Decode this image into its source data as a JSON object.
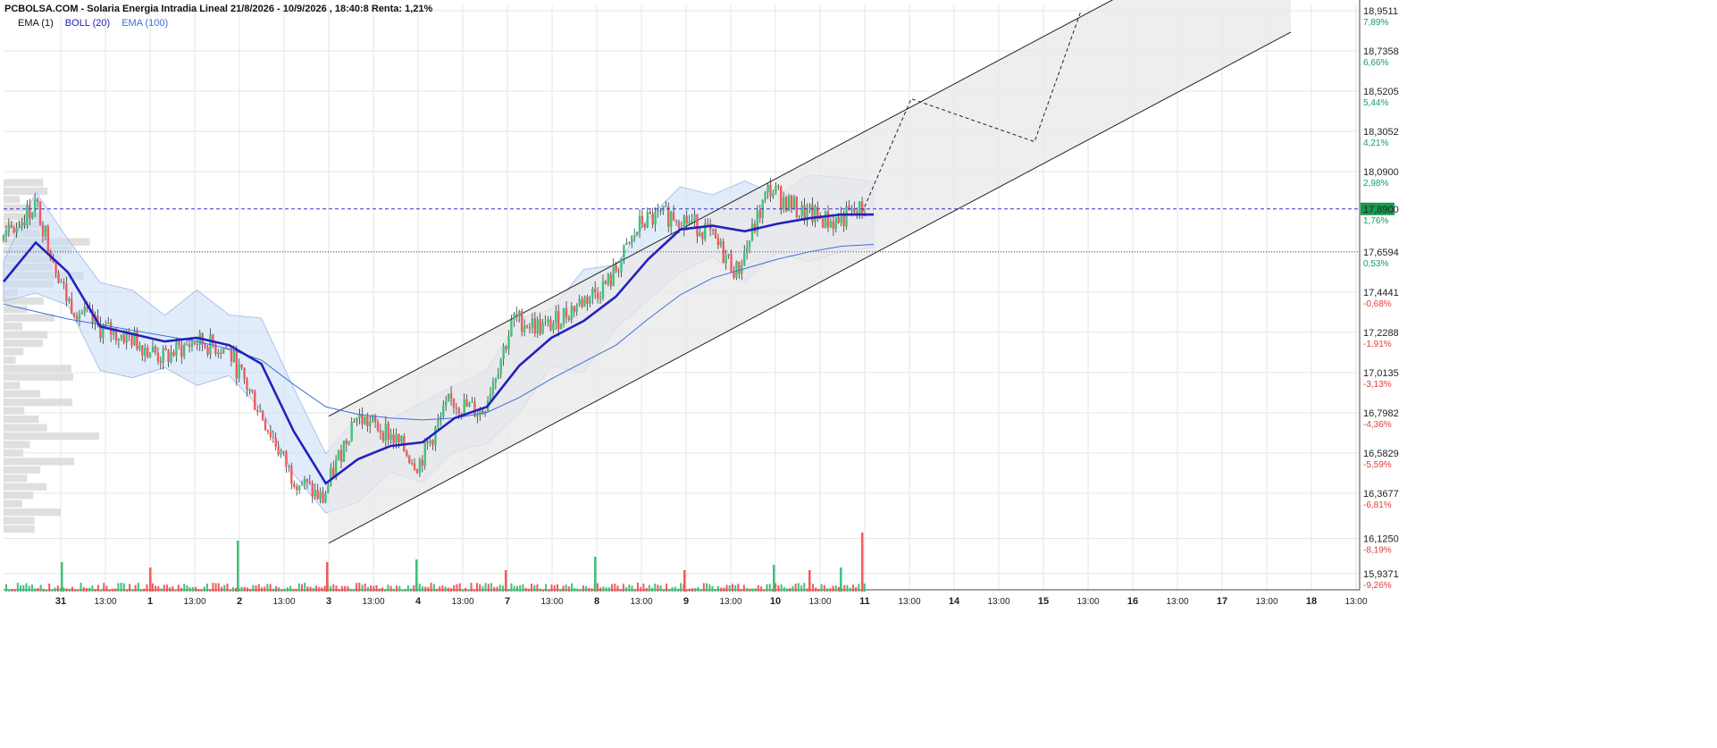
{
  "header": {
    "title": "PCBOLSA.COM - Solaria Energia Intradia Lineal 21/8/2026 - 10/9/2026 , 18:40:8 Renta: 1,21%"
  },
  "legend": [
    {
      "label": "EMA (1)",
      "color": "#111111"
    },
    {
      "label": "BOLL (20)",
      "color": "#2222bb"
    },
    {
      "label": "EMA (100)",
      "color": "#3f6fd8"
    }
  ],
  "price_axis": {
    "ticks": [
      "18,9511",
      "18,7358",
      "18,5205",
      "18,3052",
      "18,0900",
      "17,6594",
      "17,4441",
      "17,2288",
      "17,0135",
      "16,7982",
      "16,5829",
      "16,3677",
      "16,1250",
      "15,9371"
    ],
    "pcts": [
      "7,89%",
      "6,66%",
      "5,44%",
      "4,21%",
      "2,98%",
      "0,53%",
      "-0,68%",
      "-1,91%",
      "-3,13%",
      "-4,36%",
      "-5,59%",
      "-6,81%",
      "-8,19%",
      "-9,26%"
    ],
    "pct_colors": {
      "positive": "#14a05a",
      "negative": "#e03c3c"
    },
    "current_price": "17,8900",
    "current_pct": "1,76%",
    "current_color": "#159a4c"
  },
  "time_axis": {
    "labels": [
      "31",
      "13:00",
      "1",
      "13:00",
      "2",
      "13:00",
      "3",
      "13:00",
      "4",
      "13:00",
      "7",
      "13:00",
      "8",
      "13:00",
      "9",
      "13:00",
      "10",
      "13:00",
      "11",
      "13:00",
      "14",
      "13:00",
      "15",
      "13:00",
      "16",
      "13:00",
      "17",
      "13:00",
      "18",
      "13:00"
    ]
  },
  "chart_data": {
    "type": "line",
    "title": "PCBOLSA.COM - Solaria Energia Intradia Lineal 21/8/2026 - 10/9/2026 , 18:40:8 Renta: 1,21%",
    "series": [
      {
        "name": "EMA (1)",
        "values": [
          17.72,
          17.92,
          17.4,
          17.25,
          17.2,
          17.09,
          17.18,
          17.14,
          16.82,
          16.47,
          16.33,
          16.78,
          16.7,
          16.52,
          16.86,
          16.8,
          17.3,
          17.25,
          17.38,
          17.5,
          17.82,
          17.86,
          17.78,
          17.55,
          18.0,
          17.87,
          17.82,
          17.89
        ]
      },
      {
        "name": "BOLL (20)",
        "values": [
          17.5,
          17.71,
          17.55,
          17.26,
          17.22,
          17.18,
          17.2,
          17.16,
          17.06,
          16.7,
          16.42,
          16.55,
          16.62,
          16.64,
          16.77,
          16.83,
          17.05,
          17.2,
          17.29,
          17.42,
          17.62,
          17.78,
          17.8,
          17.77,
          17.81,
          17.84,
          17.86,
          17.86
        ]
      },
      {
        "name": "EMA (100)",
        "values": [
          17.38,
          17.34,
          17.3,
          17.27,
          17.24,
          17.21,
          17.18,
          17.14,
          17.08,
          16.95,
          16.83,
          16.79,
          16.77,
          16.76,
          16.77,
          16.8,
          16.88,
          16.98,
          17.07,
          17.16,
          17.3,
          17.43,
          17.52,
          17.57,
          17.62,
          17.66,
          17.69,
          17.7
        ]
      }
    ],
    "channel": {
      "lower_start": 16.1,
      "lower_end_mid": 17.65,
      "upper_start": 16.78,
      "upper_end_mid": 18.33
    },
    "projection_values": [
      17.87,
      18.48,
      18.25,
      18.95
    ],
    "current_price": 17.89,
    "previous_close": 17.66,
    "ylim": [
      15.85,
      18.98
    ],
    "xlabel": "",
    "ylabel": "",
    "volume": {
      "spikes": [
        0.55,
        0.45,
        0.95,
        0.55,
        0.6,
        0.4,
        0.65,
        0.4,
        0.5,
        0.4,
        0.45,
        1.1
      ]
    },
    "volume_profile_rows": 42
  },
  "colors": {
    "up": "#3ec27a",
    "down": "#f25a5a",
    "ema1": "#111111",
    "boll_mid": "#2222bb",
    "boll_band": "#c9dcf5",
    "ema100": "#3f6fd8",
    "channel_fill": "#e8e8e8",
    "grid": "#e6e6e6",
    "price_line": "#3333cc",
    "accent": "#159a4c"
  }
}
